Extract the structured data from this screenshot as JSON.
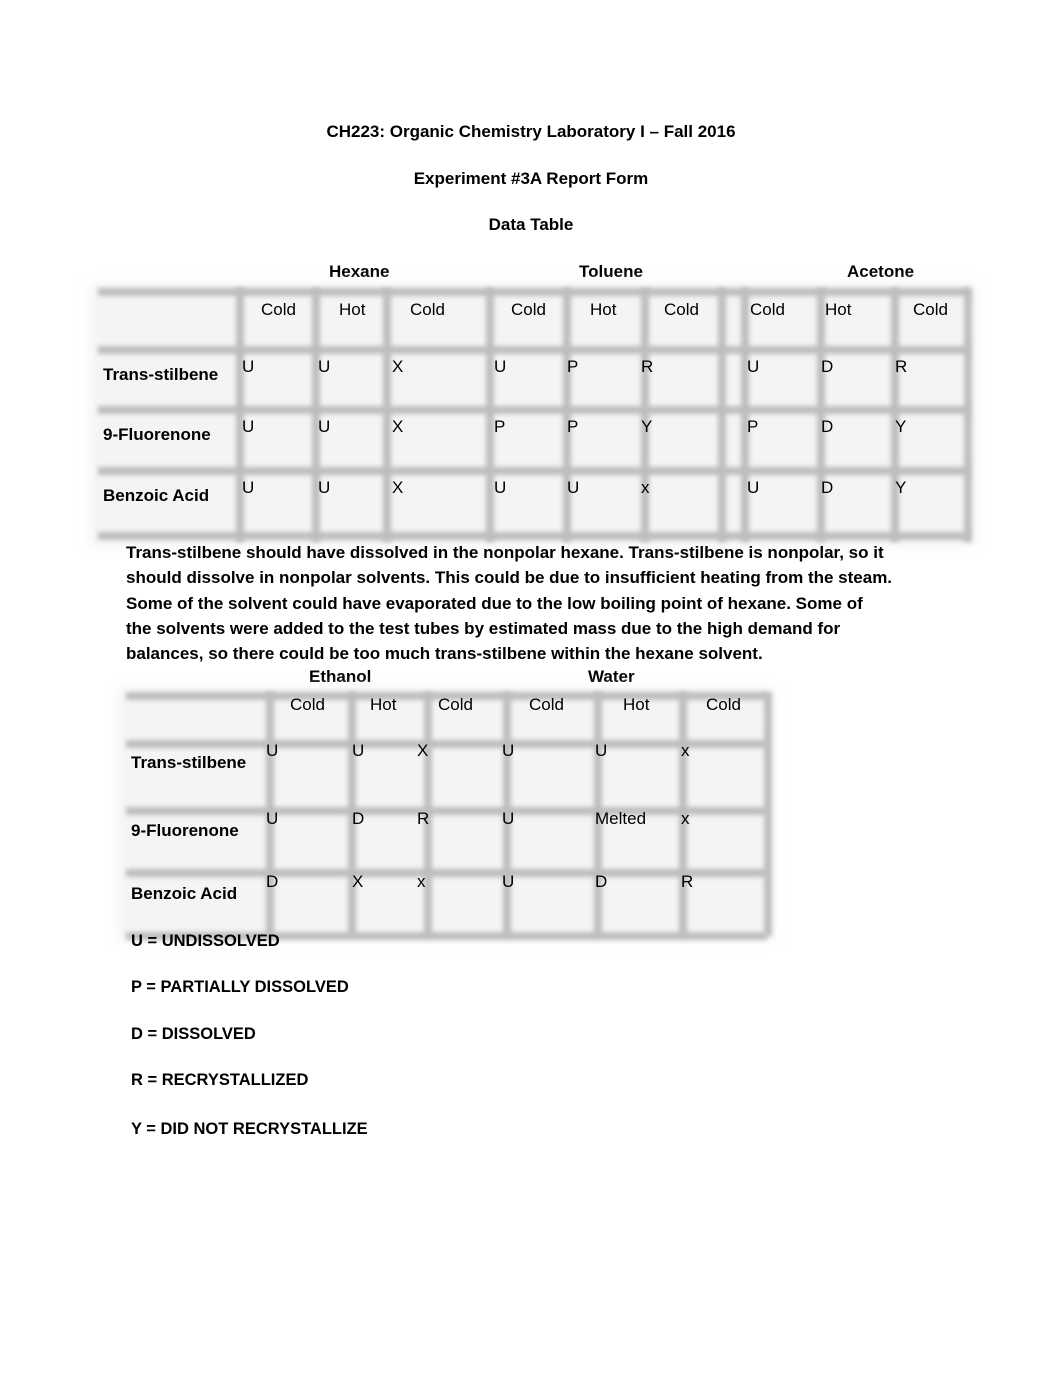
{
  "document": {
    "course_title": "CH223: Organic Chemistry Laboratory I – Fall 2016",
    "report_title": "Experiment #3A  Report Form",
    "section_title": "Data Table"
  },
  "table1": {
    "solvents": [
      "Hexane",
      "Toluene",
      "Acetone"
    ],
    "column_headers": [
      "Cold",
      "Hot",
      "Cold",
      "Cold",
      "Hot",
      "Cold",
      "Cold",
      "Hot",
      "Cold"
    ],
    "rows": [
      {
        "label": "Trans-stilbene",
        "values": [
          "U",
          "U",
          "X",
          "U",
          "P",
          "R",
          "U",
          "D",
          "R"
        ]
      },
      {
        "label": "9-Fluorenone",
        "values": [
          "U",
          "U",
          "X",
          "P",
          "P",
          "Y",
          "P",
          "D",
          "Y"
        ]
      },
      {
        "label": "Benzoic Acid",
        "values": [
          "U",
          "U",
          "X",
          "U",
          "U",
          "x",
          "U",
          "D",
          "Y"
        ]
      }
    ]
  },
  "discussion": {
    "lines": [
      "Trans-stilbene should have dissolved in the nonpolar hexane. Trans-stilbene is nonpolar, so it",
      "should dissolve in nonpolar solvents. This could be due to insufficient heating from the steam.",
      "Some of the solvent could have evaporated due to the low boiling point of hexane. Some of",
      "the solvents were added to the test tubes by estimated mass due to the high demand for",
      "balances, so there could be too much trans-stilbene within the hexane solvent."
    ]
  },
  "table2": {
    "solvents": [
      "Ethanol",
      "Water"
    ],
    "column_headers": [
      "Cold",
      "Hot",
      "Cold",
      "Cold",
      "Hot",
      "Cold"
    ],
    "rows": [
      {
        "label": "Trans-stilbene",
        "values": [
          "U",
          "U",
          "X",
          "U",
          "U",
          "x"
        ]
      },
      {
        "label": "9-Fluorenone",
        "values": [
          "U",
          "D",
          "R",
          "U",
          "Melted",
          "x"
        ]
      },
      {
        "label": "Benzoic Acid",
        "values": [
          "D",
          "X",
          "x",
          "U",
          "D",
          "R"
        ]
      }
    ]
  },
  "legend": [
    "U = UNDISSOLVED",
    "P = PARTIALLY DISSOLVED",
    "D = DISSOLVED",
    "R = RECRYSTALLIZED",
    "Y = DID NOT RECRYSTALLIZE"
  ]
}
